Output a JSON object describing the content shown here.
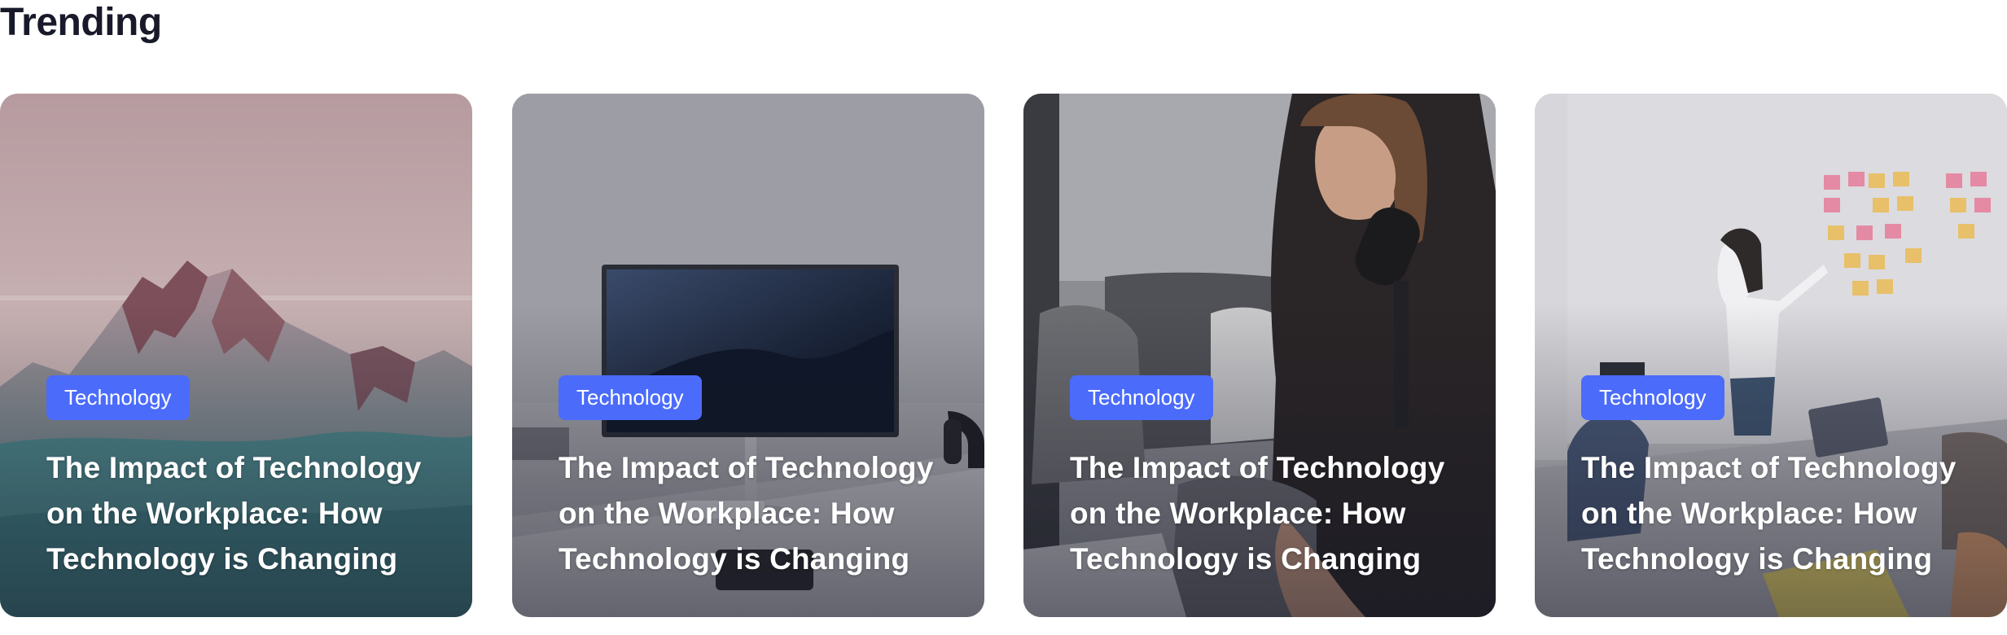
{
  "section": {
    "title": "Trending"
  },
  "cards": [
    {
      "category": "Technology",
      "title": "The Impact of Technology on the Workplace: How Technology is Changing",
      "image": "snowy-mountains-photo"
    },
    {
      "category": "Technology",
      "title": "The Impact of Technology on the Workplace: How Technology is Changing",
      "image": "desk-monitor-photo"
    },
    {
      "category": "Technology",
      "title": "The Impact of Technology on the Workplace: How Technology is Changing",
      "image": "podcast-microphone-photo"
    },
    {
      "category": "Technology",
      "title": "The Impact of Technology on the Workplace: How Technology is Changing",
      "image": "office-sticky-notes-photo"
    }
  ]
}
